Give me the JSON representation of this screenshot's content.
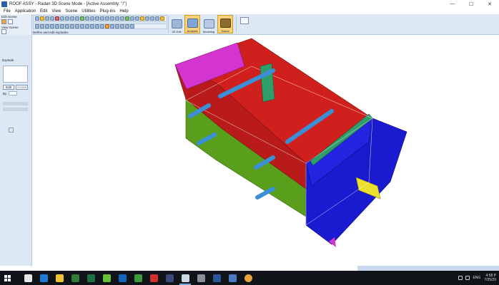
{
  "window": {
    "title": "ROOF ASSY - Radan 3D Scene Mode - [Active Assembly: \"/\"]",
    "controls": {
      "minimize": "—",
      "maximize": "☐",
      "close": "✕"
    }
  },
  "menu": {
    "items": [
      "File",
      "Application",
      "Edit",
      "View",
      "Scene",
      "Utilities",
      "Plug-ins",
      "Help"
    ]
  },
  "ribbon": {
    "edit_scene_label": "Edit Scene",
    "view_scene_label": "View Scene",
    "explode_hint": "Define and edit explodes",
    "buttons": [
      {
        "label": "3D Edit",
        "icon": "edit-3d-icon"
      },
      {
        "label": "Analysis",
        "icon": "analysis-icon"
      },
      {
        "label": "Modeling",
        "icon": "modeling-icon"
      },
      {
        "label": "Scene",
        "icon": "scene-icon"
      }
    ]
  },
  "leftpanel": {
    "explode_title": "Explode",
    "edit_button": "Edit",
    "new_button": "Create",
    "by_label": "By"
  },
  "taskbar": {
    "apps": [
      {
        "name": "task-view",
        "color": "#e6e6e6"
      },
      {
        "name": "edge",
        "color": "#1f7ad6"
      },
      {
        "name": "file-explorer",
        "color": "#f1c232"
      },
      {
        "name": "excel-x",
        "color": "#2e7d32"
      },
      {
        "name": "excel",
        "color": "#1e7145"
      },
      {
        "name": "green-app",
        "color": "#6abf3a"
      },
      {
        "name": "outlook",
        "color": "#1565c0"
      },
      {
        "name": "green-e-app",
        "color": "#3c9b3c"
      },
      {
        "name": "acrobat",
        "color": "#d32f2f"
      },
      {
        "name": "media-app",
        "color": "#3b4a7a"
      },
      {
        "name": "radan",
        "color": "#cfd8e6"
      },
      {
        "name": "photos",
        "color": "#8a8f99"
      },
      {
        "name": "word",
        "color": "#2b579a"
      },
      {
        "name": "blue-app",
        "color": "#4a79c4"
      },
      {
        "name": "chrome",
        "color": "#e8a33a"
      }
    ],
    "clock": {
      "time": "4:58 P",
      "date": "7/25/20"
    },
    "lang": "ENG"
  },
  "colors": {
    "box_red": "#d0201e",
    "box_green": "#5a9f1c",
    "box_blue": "#1a1ad0",
    "box_magenta": "#d435d0",
    "pipe": "#3a8fd6",
    "bracket": "#2f9e6a",
    "tab_yellow": "#ede02c"
  }
}
